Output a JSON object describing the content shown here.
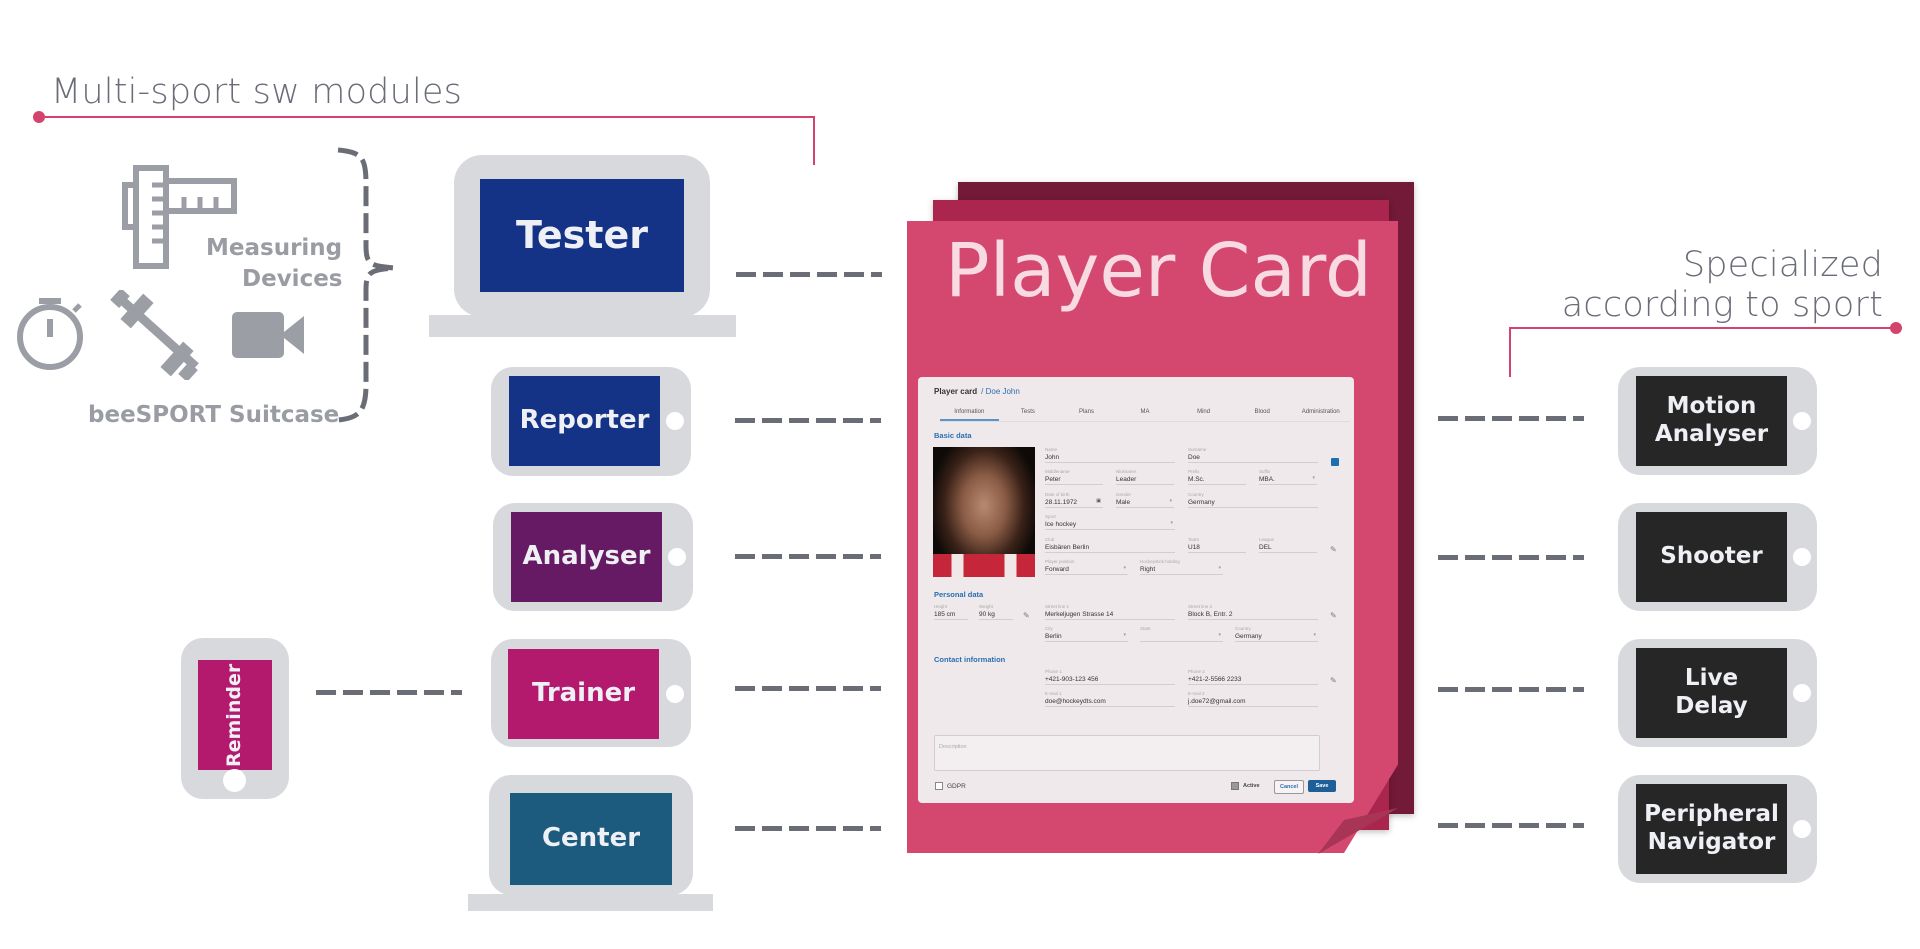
{
  "headings": {
    "left": "Multi-sport sw modules",
    "right_line1": "Specialized",
    "right_line2": "according to sport"
  },
  "colors": {
    "accent_pink": "#d4436e",
    "tester_blue": "#143386",
    "analyser_purple": "#651a63",
    "trainer_magenta": "#b3196c",
    "center_teal": "#1c5a7e",
    "specialized_dark": "#262626",
    "card_front": "#d4486f",
    "card_mid": "#ab264f",
    "card_back": "#731a38"
  },
  "suitcase": {
    "measuring_line1": "Measuring",
    "measuring_line2": "Devices",
    "label": "beeSPORT Suitcase",
    "icons": [
      "ruler-icon",
      "stopwatch-icon",
      "dumbbell-icon",
      "video-camera-icon"
    ]
  },
  "modules": [
    {
      "label": "Tester",
      "device": "laptop"
    },
    {
      "label": "Reporter",
      "device": "tablet"
    },
    {
      "label": "Analyser",
      "device": "tablet"
    },
    {
      "label": "Trainer",
      "device": "tablet"
    },
    {
      "label": "Center",
      "device": "laptop"
    },
    {
      "label": "Reminder",
      "device": "phone"
    }
  ],
  "specialized": [
    {
      "line1": "Motion",
      "line2": "Analyser"
    },
    {
      "line1": "Shooter",
      "line2": ""
    },
    {
      "line1": "Live",
      "line2": "Delay"
    },
    {
      "line1": "Peripheral",
      "line2": "Navigator"
    }
  ],
  "player_card": {
    "title": "Player Card",
    "breadcrumb": {
      "root": "Player card",
      "current": "/ Doe John"
    },
    "tabs": [
      "Information",
      "Tests",
      "Plans",
      "MA",
      "Mind",
      "Blood",
      "Administration"
    ],
    "active_tab": "Information",
    "sections": {
      "basic": "Basic data",
      "personal": "Personal data",
      "contact": "Contact information"
    },
    "basic": {
      "name": {
        "label": "Name",
        "value": "John"
      },
      "surname": {
        "label": "Surname",
        "value": "Doe"
      },
      "middlename": {
        "label": "Middlename",
        "value": "Peter"
      },
      "nickname": {
        "label": "Nickname",
        "value": "Leader"
      },
      "prefix": {
        "label": "Prefix",
        "value": "M.Sc."
      },
      "suffix": {
        "label": "Suffix",
        "value": "MBA."
      },
      "dob": {
        "label": "Date of birth",
        "value": "28.11.1972"
      },
      "gender": {
        "label": "Gender",
        "value": "Male"
      },
      "country": {
        "label": "Country",
        "value": "Germany"
      },
      "sport": {
        "label": "Sport",
        "value": "Ice hockey"
      },
      "club": {
        "label": "Club",
        "value": "Eisbären Berlin"
      },
      "team": {
        "label": "Team",
        "value": "U18"
      },
      "league": {
        "label": "League",
        "value": "DEL"
      },
      "position": {
        "label": "Player position",
        "value": "Forward"
      },
      "stick": {
        "label": "Hockeystick holding",
        "value": "Right"
      }
    },
    "personal": {
      "height": {
        "label": "Height",
        "value": "185 cm"
      },
      "weight": {
        "label": "Weight",
        "value": "90 kg"
      },
      "street1": {
        "label": "Street line 1",
        "value": "Merkeljugen Strasse 14"
      },
      "street2": {
        "label": "Street line 2",
        "value": "Block B, Entr. 2"
      },
      "city": {
        "label": "City",
        "value": "Berlin"
      },
      "state": {
        "label": "State",
        "value": ""
      },
      "country": {
        "label": "Country",
        "value": "Germany"
      }
    },
    "contact": {
      "phone1": {
        "label": "Phone 1",
        "value": "+421-903-123 456"
      },
      "phone2": {
        "label": "Phone 2",
        "value": "+421-2-5566 2233"
      },
      "email1": {
        "label": "E-mail 1",
        "value": "doe@hockeydts.com"
      },
      "email2": {
        "label": "E-mail 2",
        "value": "j.doe72@gmail.com"
      }
    },
    "description_placeholder": "Description",
    "gdpr_label": "GDPR",
    "gdpr_checked": false,
    "active_label": "Active",
    "active_checked": true,
    "cancel_label": "Cancel",
    "save_label": "Save"
  }
}
